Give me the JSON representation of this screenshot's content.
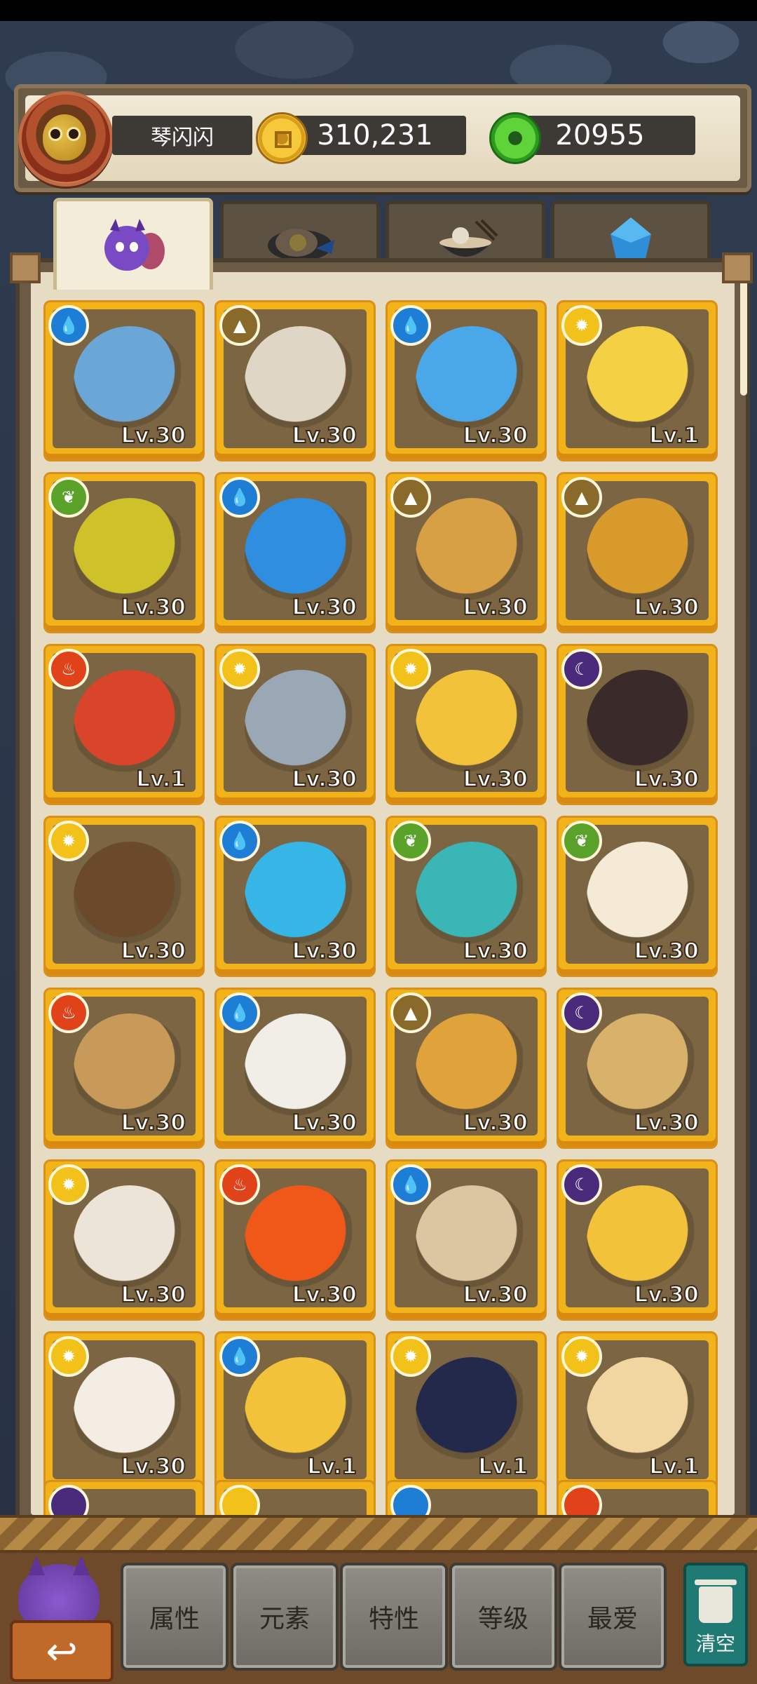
{
  "player": {
    "name": "琴闪闪",
    "coins": "310,231",
    "gems": "20955"
  },
  "tabs": [
    {
      "icon": "monster-tab-icon",
      "active": true
    },
    {
      "icon": "food-tab-icon",
      "active": false
    },
    {
      "icon": "noodle-bowl-tab-icon",
      "active": false
    },
    {
      "icon": "crystal-tab-icon",
      "active": false
    }
  ],
  "cards": [
    {
      "name": "masked-swordsman-card",
      "element": "water",
      "level": "Lv.30",
      "color": "#6aa6d6"
    },
    {
      "name": "golden-armored-warrior-card",
      "element": "earth",
      "level": "Lv.30",
      "color": "#e0d6c6"
    },
    {
      "name": "blue-axolotl-card",
      "element": "water",
      "level": "Lv.30",
      "color": "#4aa8e8"
    },
    {
      "name": "capricorn-star-card",
      "element": "light",
      "level": "Lv.1",
      "color": "#f4d044"
    },
    {
      "name": "golden-bow-card",
      "element": "nature",
      "level": "Lv.30",
      "color": "#cfc12a"
    },
    {
      "name": "water-orb-card",
      "element": "water",
      "level": "Lv.30",
      "color": "#2f8ee0"
    },
    {
      "name": "leo-star-card",
      "element": "earth",
      "level": "Lv.30",
      "color": "#d8a044"
    },
    {
      "name": "golden-monkey-charm-card",
      "element": "earth",
      "level": "Lv.30",
      "color": "#d89a2a"
    },
    {
      "name": "red-drum-pig-card",
      "element": "fire",
      "level": "Lv.1",
      "color": "#d8452a"
    },
    {
      "name": "astronaut-bubble-card",
      "element": "light",
      "level": "Lv.30",
      "color": "#9aa8b6"
    },
    {
      "name": "gold-ingot-ox-card",
      "element": "light",
      "level": "Lv.30",
      "color": "#f2c23a"
    },
    {
      "name": "birthday-princess-card",
      "element": "dark",
      "level": "Lv.30",
      "color": "#3a2a2a"
    },
    {
      "name": "archer-boy-card",
      "element": "light",
      "level": "Lv.30",
      "color": "#6a4a2a"
    },
    {
      "name": "aquarius-star-card",
      "element": "water",
      "level": "Lv.30",
      "color": "#36b6e6"
    },
    {
      "name": "teal-bubble-fish-card",
      "element": "nature",
      "level": "Lv.30",
      "color": "#3ab6b6"
    },
    {
      "name": "santa-hat-blob-card",
      "element": "nature",
      "level": "Lv.30",
      "color": "#f4ead6"
    },
    {
      "name": "cake-bear-card",
      "element": "fire",
      "level": "Lv.30",
      "color": "#c89a5a"
    },
    {
      "name": "antler-bunny-card",
      "element": "water",
      "level": "Lv.30",
      "color": "#f0eee6"
    },
    {
      "name": "ginkgo-branch-card",
      "element": "earth",
      "level": "Lv.30",
      "color": "#e0a23a"
    },
    {
      "name": "scholar-scroll-card",
      "element": "dark",
      "level": "Lv.30",
      "color": "#d8b26a"
    },
    {
      "name": "box-mouse-card",
      "element": "light",
      "level": "Lv.30",
      "color": "#ece4d6"
    },
    {
      "name": "fire-spirit-card",
      "element": "fire",
      "level": "Lv.30",
      "color": "#f0581a"
    },
    {
      "name": "sprout-sprite-card",
      "element": "water",
      "level": "Lv.30",
      "color": "#dcc6a2"
    },
    {
      "name": "yellow-bird-sword-card",
      "element": "dark",
      "level": "Lv.30",
      "color": "#f2c23a"
    },
    {
      "name": "candle-ghost-card",
      "element": "light",
      "level": "Lv.30",
      "color": "#f4ede4"
    },
    {
      "name": "fan-chick-card",
      "element": "water",
      "level": "Lv.1",
      "color": "#f2c23a"
    },
    {
      "name": "moon-cow-card",
      "element": "light",
      "level": "Lv.1",
      "color": "#23294a"
    },
    {
      "name": "chess-piece-card",
      "element": "light",
      "level": "Lv.1",
      "color": "#f2d6a2"
    }
  ],
  "partial_row": [
    {
      "element": "dark"
    },
    {
      "element": "light"
    },
    {
      "element": "water"
    },
    {
      "element": "fire"
    }
  ],
  "filters": {
    "attribute": "属性",
    "element": "元素",
    "trait": "特性",
    "level": "等级",
    "favorite": "最爱",
    "clear": "清空"
  },
  "back_label": "↩"
}
